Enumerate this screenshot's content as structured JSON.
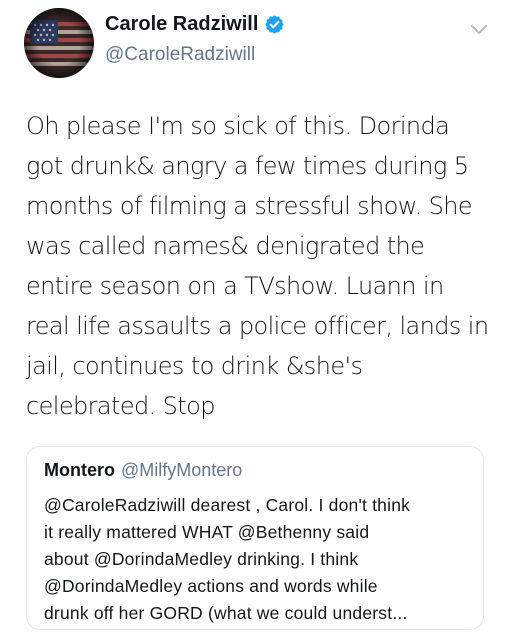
{
  "author": {
    "name": "Carole Radziwill",
    "handle": "@CaroleRadziwill",
    "verified": true,
    "avatar_icon": "american-flag-avatar"
  },
  "tweet": {
    "lines": [
      "Oh please I'm so sick of this. Dorinda",
      "got drunk& angry a few times during 5",
      "months of filming a stressful show. She",
      "was called names& denigrated the",
      "entire season on a TVshow. Luann in",
      "real life assaults a police officer, lands in",
      "jail, continues to drink &she's",
      "celebrated. Stop"
    ]
  },
  "quoted_tweet": {
    "name": "Montero",
    "handle": "@MilfyMontero",
    "lines": [
      "@CaroleRadziwill dearest , Carol. I don't think",
      "it really mattered WHAT @Bethenny said",
      "about @DorindaMedley drinking. I think",
      "@DorindaMedley actions and words while",
      "drunk off her GORD (what we could underst..."
    ]
  },
  "colors": {
    "text": "#14171a",
    "secondary_text": "#657786",
    "verified_badge": "#1da1f2",
    "border": "#e1e8ed"
  },
  "icons": {
    "verified": "verified-badge-icon",
    "more": "chevron-down-icon"
  }
}
